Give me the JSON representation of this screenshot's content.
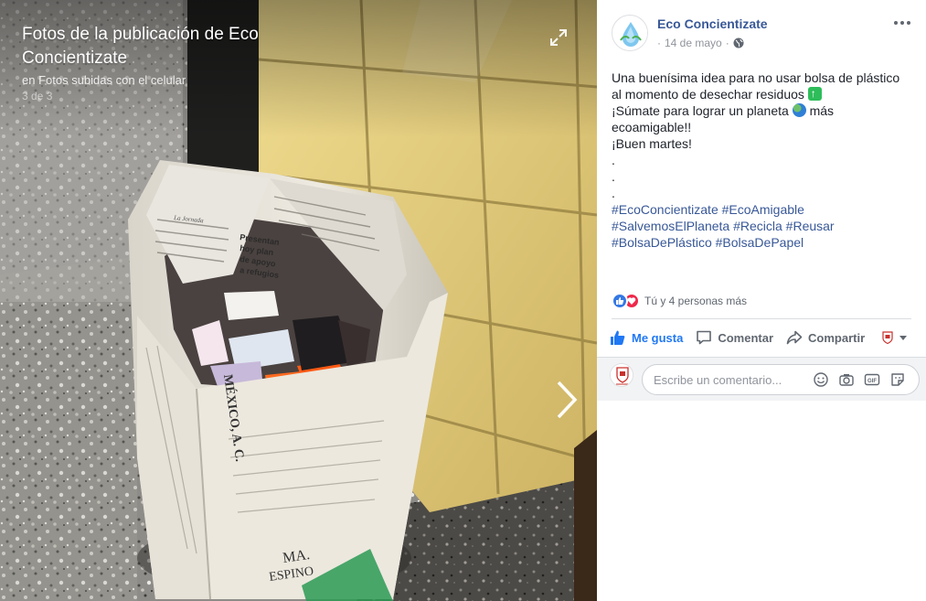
{
  "photo": {
    "title": "Fotos de la publicación de Eco Concientizate",
    "subtitle": "en Fotos subidas con el celular",
    "count": "3 de 3",
    "newspaper_texts": {
      "headline_1": "Presentan",
      "headline_2": "hoy plan",
      "headline_3": "de apoyo",
      "headline_4": "a refugios",
      "section": "La Jornada",
      "org": "MÉXICO, A. C.",
      "name_1": "MA.",
      "name_2": "ESPINO"
    }
  },
  "post": {
    "page_name": "Eco Concientizate",
    "date": "14 de mayo",
    "lines": [
      "Una buenísima idea para no usar bolsa de plástico",
      "al momento de desechar residuos",
      "¡Súmate para lograr un planeta",
      "más",
      "ecoamigable!!",
      "¡Buen martes!",
      ".",
      ".",
      "."
    ],
    "hashtags": [
      "#EcoConcientizate",
      "#EcoAmigable",
      "#SalvemosElPlaneta",
      "#Recicla",
      "#Reusar",
      "#BolsaDePlástico",
      "#BolsaDePapel"
    ],
    "reactions_text": "Tú y 4 personas más"
  },
  "actions": {
    "like": "Me gusta",
    "comment": "Comentar",
    "share": "Compartir"
  },
  "comment_box": {
    "placeholder": "Escribe un comentario..."
  },
  "icons": {
    "expand": "expand-icon",
    "next": "chevron-right-icon",
    "globe": "globe-icon",
    "more": "more-dots-icon",
    "like": "thumbs-up-icon",
    "love": "heart-icon",
    "comment": "comment-icon",
    "share": "share-icon",
    "emoji": "emoji-icon",
    "camera": "camera-icon",
    "gif": "gif-icon",
    "sticker": "sticker-icon"
  },
  "colors": {
    "link": "#385898",
    "like_blue": "#2078f4",
    "tile_yellow": "#e8cf7a",
    "bag_paper": "#e7e2d6"
  }
}
